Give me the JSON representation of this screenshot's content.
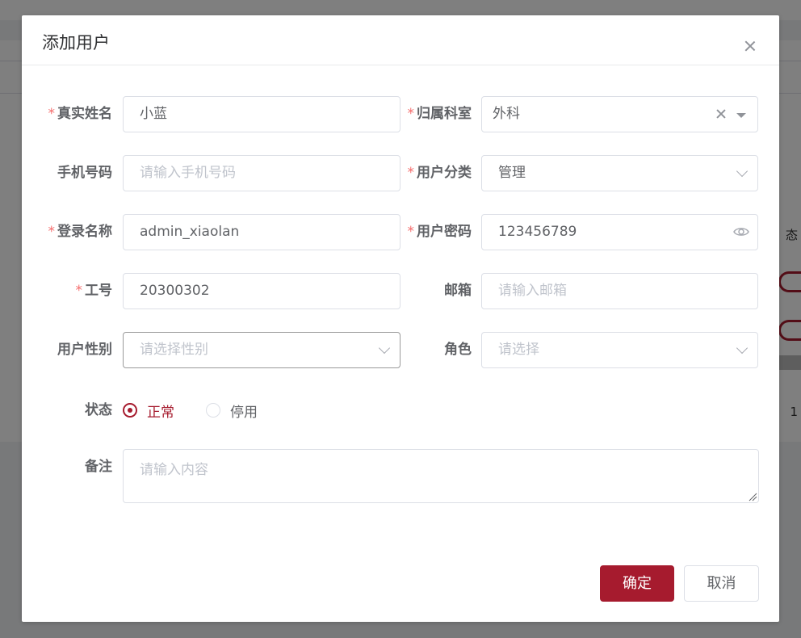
{
  "background": {
    "column_header": "态",
    "page_number": "1"
  },
  "dialog": {
    "title": "添加用户"
  },
  "form": {
    "required_mark": "*",
    "real_name": {
      "label": "真实姓名",
      "value": "小蓝",
      "required": true
    },
    "department": {
      "label": "归属科室",
      "value": "外科",
      "required": true
    },
    "phone": {
      "label": "手机号码",
      "placeholder": "请输入手机号码"
    },
    "user_category": {
      "label": "用户分类",
      "value": "管理",
      "required": true
    },
    "login_name": {
      "label": "登录名称",
      "value": "admin_xiaolan",
      "required": true
    },
    "password": {
      "label": "用户密码",
      "value": "123456789",
      "required": true
    },
    "employee_no": {
      "label": "工号",
      "value": "20300302",
      "required": true
    },
    "email": {
      "label": "邮箱",
      "placeholder": "请输入邮箱"
    },
    "gender": {
      "label": "用户性别",
      "placeholder": "请选择性别"
    },
    "role": {
      "label": "角色",
      "placeholder": "请选择"
    },
    "status": {
      "label": "状态",
      "options": [
        "正常",
        "停用"
      ],
      "selected": "正常"
    },
    "remark": {
      "label": "备注",
      "placeholder": "请输入内容"
    }
  },
  "footer": {
    "confirm_label": "确定",
    "cancel_label": "取消"
  },
  "colors": {
    "primary": "#a61b2e",
    "required": "#f56c6c",
    "placeholder": "#c0c4cc",
    "text": "#606266"
  }
}
